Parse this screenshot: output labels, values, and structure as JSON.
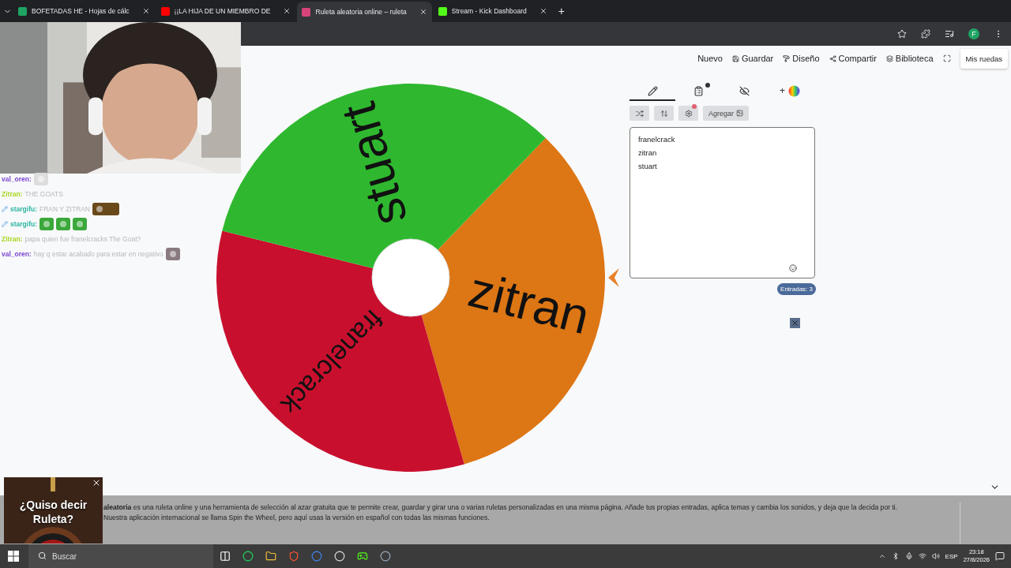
{
  "browser": {
    "tabs": [
      {
        "title": "BOFETADAS HE - Hojas de cálc",
        "kind": "sheets",
        "selected": false
      },
      {
        "title": "¡¡LA HIJA DE UN MIEMBRO DE",
        "kind": "video",
        "selected": false
      },
      {
        "title": "Ruleta aleatoria online – ruleta",
        "kind": "wheel",
        "selected": true
      },
      {
        "title": "Stream - Kick Dashboard",
        "kind": "kick",
        "selected": false
      }
    ],
    "new_tab": "+",
    "profile_initial": "F"
  },
  "nav": [
    {
      "label": "Nuevo",
      "kind": "new"
    },
    {
      "label": "Guardar",
      "kind": "save"
    },
    {
      "label": "Diseño",
      "kind": "design"
    },
    {
      "label": "Compartir",
      "kind": "share"
    },
    {
      "label": "Biblioteca",
      "kind": "library"
    },
    {
      "kind": "fullscreen"
    }
  ],
  "my_wheels": "Mis ruedas",
  "panel_tabs": [
    {
      "kind": "edit",
      "selected": true,
      "badge": false
    },
    {
      "kind": "results",
      "selected": false,
      "badge": true
    },
    {
      "kind": "hide",
      "selected": false,
      "badge": false
    },
    {
      "kind": "colors",
      "label": "+",
      "selected": false,
      "badge": false
    }
  ],
  "tools": [
    {
      "kind": "shuffle",
      "alert": false
    },
    {
      "kind": "sort",
      "alert": false
    },
    {
      "kind": "advanced",
      "alert": true
    },
    {
      "kind": "add",
      "label": "Agregar",
      "alert": false
    }
  ],
  "entries": [
    "franelcrack",
    "zitran",
    "stuart"
  ],
  "entries_count": "Entradas: 3",
  "wheel": {
    "slices": [
      {
        "label": "zitran",
        "color": "#dd7614"
      },
      {
        "label": "franelcrack",
        "color": "#c8102e"
      },
      {
        "label": "stuart",
        "color": "#2fb82f"
      }
    ]
  },
  "chat": [
    {
      "user": "val_oren:",
      "color": "#7a45d0",
      "emotes": [
        {
          "kind": "penguin"
        }
      ]
    },
    {
      "user": "Zitran:",
      "color": "#a8d61e",
      "text": "THE GOATS"
    },
    {
      "badges": [
        {
          "kind": "sword"
        }
      ],
      "user": "stargifu:",
      "color": "#2bb5a0",
      "text": "FRAN Y ZITRAN",
      "emotes": [
        {
          "kind": "faces"
        }
      ]
    },
    {
      "badges": [
        {
          "kind": "sword"
        }
      ],
      "user": "stargifu:",
      "color": "#2bb5a0",
      "emotes": [
        {
          "kind": "frog"
        },
        {
          "kind": "frog"
        },
        {
          "kind": "frog"
        }
      ]
    },
    {
      "user": "Zitran:",
      "color": "#a8d61e",
      "text": "papa quien fue franelcracks The Goat?"
    },
    {
      "user": "val_oren:",
      "color": "#7a45d0",
      "text": "hay q estar acabado para estar en negativo"
    }
  ],
  "info": {
    "text": "**aleatoria** es una ruleta online y una herramienta de selección al azar gratuita que te permite crear, guardar y girar una o varias ruletas personalizadas en una misma página. Añade tus propias entradas, aplica temas y cambia los sonidos, y deja que la decida por ti. Nuestra aplicación internacional se llama Spin the Wheel, pero aquí usas la versión en español con todas las mismas funciones."
  },
  "ad": {
    "title": "¿Quiso decir Ruleta?"
  },
  "taskbar": {
    "search_placeholder": "Buscar",
    "apps": [
      {
        "kind": "taskview"
      },
      {
        "kind": "spotify"
      },
      {
        "kind": "files"
      },
      {
        "kind": "brave"
      },
      {
        "kind": "chrome"
      },
      {
        "kind": "obs"
      },
      {
        "kind": "kick"
      },
      {
        "kind": "steam"
      }
    ],
    "language": "ESP",
    "time": "23:18",
    "date": "27/8/2026"
  }
}
